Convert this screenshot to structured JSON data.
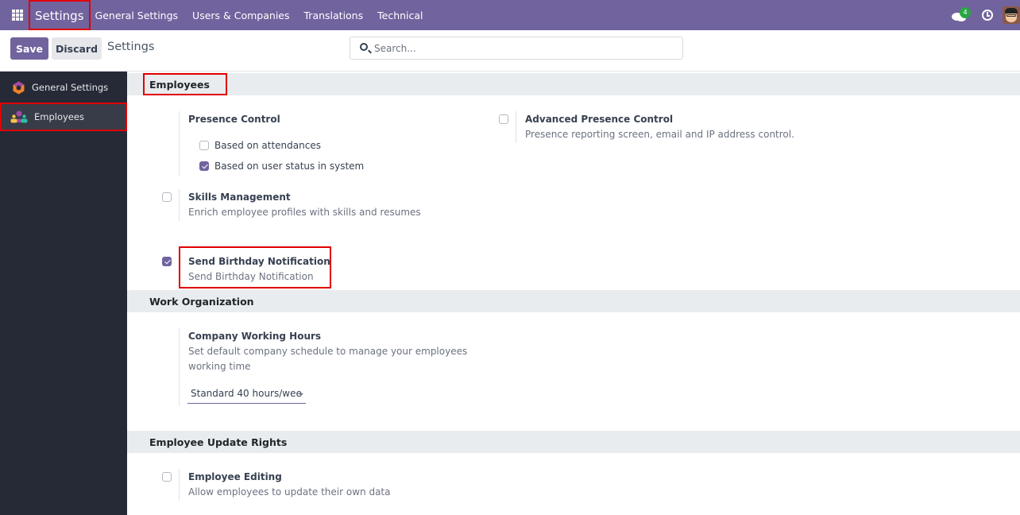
{
  "navbar": {
    "app_name": "Settings",
    "menu": [
      "General Settings",
      "Users & Companies",
      "Translations",
      "Technical"
    ],
    "chat_badge_count": "4",
    "colors": {
      "navbar_bg": "#71639e",
      "highlight": "#e00000",
      "badge": "#28a745"
    }
  },
  "control_panel": {
    "save_label": "Save",
    "discard_label": "Discard",
    "breadcrumb": "Settings",
    "search_placeholder": "Search...",
    "search_value": ""
  },
  "sidebar": {
    "items": [
      {
        "label": "General Settings",
        "icon": "general-settings-icon",
        "active": false
      },
      {
        "label": "Employees",
        "icon": "employees-icon",
        "active": true
      }
    ]
  },
  "sections": {
    "employees": {
      "title": "Employees",
      "presence_control": {
        "title": "Presence Control",
        "options": [
          {
            "label": "Based on attendances",
            "checked": false
          },
          {
            "label": "Based on user status in system",
            "checked": true
          }
        ]
      },
      "advanced_presence": {
        "title": "Advanced Presence Control",
        "description": "Presence reporting screen, email and IP address control.",
        "checked": false
      },
      "skills": {
        "title": "Skills Management",
        "description": "Enrich employee profiles with skills and resumes",
        "checked": false
      },
      "birthday": {
        "title": "Send Birthday Notification",
        "description": "Send Birthday Notification",
        "checked": true
      }
    },
    "work_organization": {
      "title": "Work Organization",
      "working_hours": {
        "title": "Company Working Hours",
        "description_line1": "Set default company schedule to manage your employees",
        "description_line2": "working time",
        "selected": "Standard 40 hours/wee"
      }
    },
    "update_rights": {
      "title": "Employee Update Rights",
      "editing": {
        "title": "Employee Editing",
        "description": "Allow employees to update their own data",
        "checked": false
      }
    }
  }
}
